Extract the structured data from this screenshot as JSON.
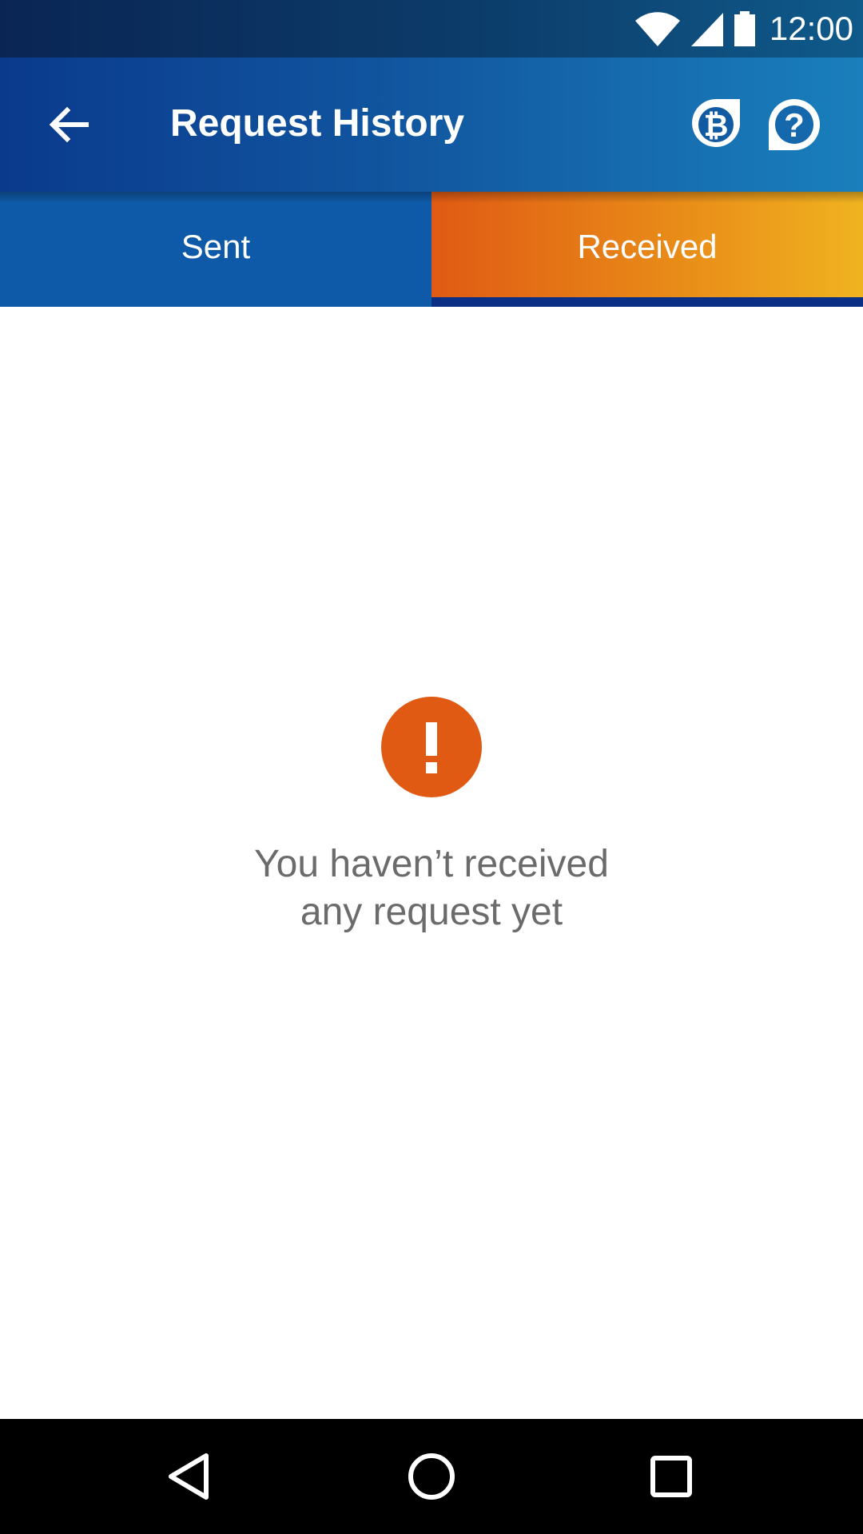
{
  "status_bar": {
    "time": "12:00",
    "icons": [
      "wifi-icon",
      "signal-icon",
      "battery-icon"
    ]
  },
  "app_bar": {
    "title": "Request History",
    "back_icon": "arrow-back-icon",
    "actions": [
      "bitcoin-icon",
      "help-icon"
    ]
  },
  "tabs": [
    {
      "label": "Sent",
      "selected": false
    },
    {
      "label": "Received",
      "selected": true
    }
  ],
  "empty_state": {
    "icon": "alert-icon",
    "line1": "You haven’t received",
    "line2": "any request yet"
  },
  "nav_bar": {
    "buttons": [
      "nav-back-icon",
      "nav-home-icon",
      "nav-recents-icon"
    ]
  },
  "colors": {
    "app_bar_start": "#0a3a8c",
    "app_bar_end": "#1a7fbc",
    "sent_tab": "#0f5aa8",
    "received_start": "#e05a14",
    "received_end": "#f0b320",
    "indicator": "#0c2f86",
    "alert": "#e05a14",
    "empty_text": "#6b6b6b"
  }
}
